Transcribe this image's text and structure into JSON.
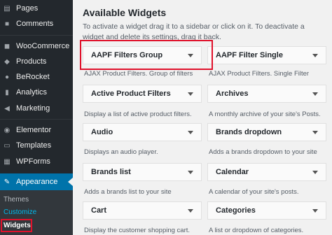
{
  "sidebar": {
    "items": [
      {
        "label": "Pages",
        "icon": "pages-icon",
        "glyph": "▤"
      },
      {
        "label": "Comments",
        "icon": "comments-icon",
        "glyph": "■"
      },
      {
        "label": "WooCommerce",
        "icon": "woocommerce-icon",
        "glyph": "◼"
      },
      {
        "label": "Products",
        "icon": "products-icon",
        "glyph": "◆"
      },
      {
        "label": "BeRocket",
        "icon": "berocket-icon",
        "glyph": "●"
      },
      {
        "label": "Analytics",
        "icon": "analytics-icon",
        "glyph": "▮"
      },
      {
        "label": "Marketing",
        "icon": "marketing-icon",
        "glyph": "◀"
      },
      {
        "label": "Elementor",
        "icon": "elementor-icon",
        "glyph": "◉"
      },
      {
        "label": "Templates",
        "icon": "templates-icon",
        "glyph": "▭"
      },
      {
        "label": "WPForms",
        "icon": "wpforms-icon",
        "glyph": "▦"
      },
      {
        "label": "Appearance",
        "icon": "appearance-icon",
        "glyph": "✎"
      }
    ],
    "submenu": {
      "themes": "Themes",
      "customize": "Customize",
      "widgets": "Widgets"
    }
  },
  "main": {
    "title": "Available Widgets",
    "description": "To activate a widget drag it to a sidebar or click on it. To deactivate a widget and delete its settings, drag it back.",
    "widgets": [
      {
        "name": "AAPF Filters Group",
        "desc": "AJAX Product Filters. Group of filters"
      },
      {
        "name": "AAPF Filter Single",
        "desc": "AJAX Product Filters. Single Filter"
      },
      {
        "name": "Active Product Filters",
        "desc": "Display a list of active product filters."
      },
      {
        "name": "Archives",
        "desc": "A monthly archive of your site's Posts."
      },
      {
        "name": "Audio",
        "desc": "Displays an audio player."
      },
      {
        "name": "Brands dropdown",
        "desc": "Adds a brands dropdown to your site"
      },
      {
        "name": "Brands list",
        "desc": "Adds a brands list to your site"
      },
      {
        "name": "Calendar",
        "desc": "A calendar of your site's posts."
      },
      {
        "name": "Cart",
        "desc": "Display the customer shopping cart."
      },
      {
        "name": "Categories",
        "desc": "A list or dropdown of categories."
      }
    ]
  },
  "colors": {
    "sidebar_bg": "#23282d",
    "active_menu": "#0073aa",
    "highlight": "#e0112b",
    "customize_link": "#00b9eb"
  }
}
